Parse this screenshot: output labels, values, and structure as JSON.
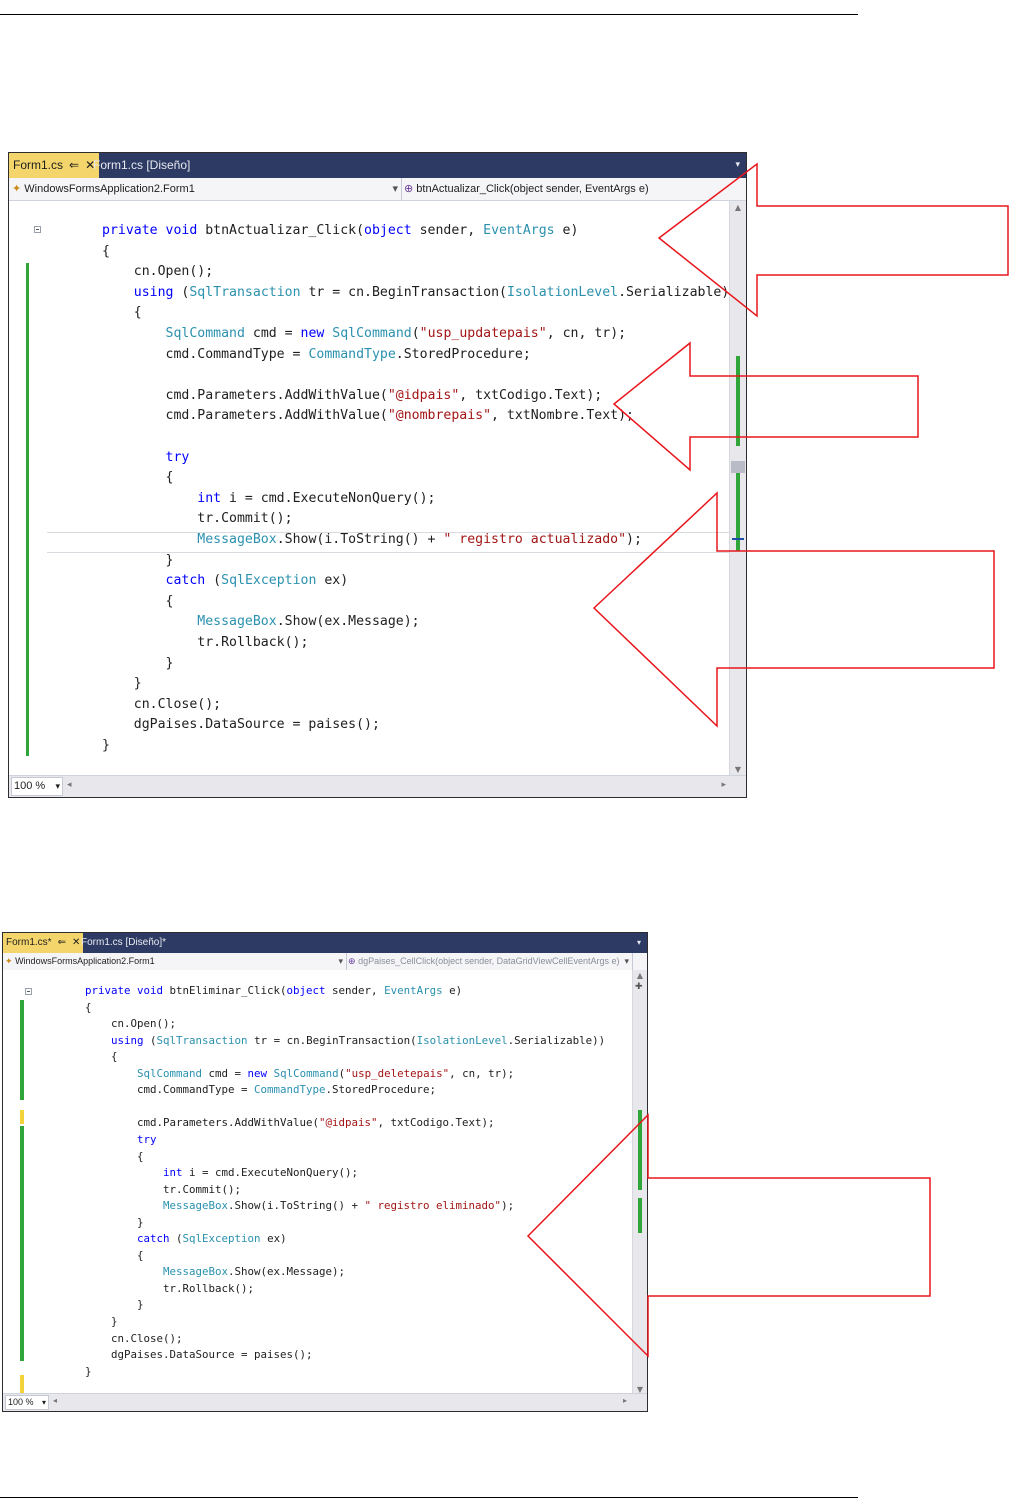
{
  "screenshot1": {
    "tabs": [
      {
        "label": "Form1.cs",
        "active": true,
        "pin": "⇐",
        "close": "✕"
      },
      {
        "label": "Form1.cs [Diseño]",
        "active": false
      }
    ],
    "nav_left": "WindowsFormsApplication2.Form1",
    "nav_right": "btnActualizar_Click(object sender, EventArgs e)",
    "zoom": "100 %",
    "lines": [
      [
        {
          "t": "private void ",
          "c": "kw"
        },
        {
          "t": "btnActualizar_Click("
        },
        {
          "t": "object",
          "c": "kw"
        },
        {
          "t": " sender, "
        },
        {
          "t": "EventArgs",
          "c": "ty"
        },
        {
          "t": " e)"
        }
      ],
      [
        {
          "t": "{"
        }
      ],
      [
        {
          "t": "    cn.Open();"
        }
      ],
      [
        {
          "t": "    "
        },
        {
          "t": "using",
          "c": "kw"
        },
        {
          "t": " ("
        },
        {
          "t": "SqlTransaction",
          "c": "ty"
        },
        {
          "t": " tr = cn.BeginTransaction("
        },
        {
          "t": "IsolationLevel",
          "c": "ty"
        },
        {
          "t": ".Serializable))"
        }
      ],
      [
        {
          "t": "    {"
        }
      ],
      [
        {
          "t": "        "
        },
        {
          "t": "SqlCommand",
          "c": "ty"
        },
        {
          "t": " cmd = "
        },
        {
          "t": "new",
          "c": "kw"
        },
        {
          "t": " "
        },
        {
          "t": "SqlCommand",
          "c": "ty"
        },
        {
          "t": "("
        },
        {
          "t": "\"usp_updatepais\"",
          "c": "st"
        },
        {
          "t": ", cn, tr);"
        }
      ],
      [
        {
          "t": "        cmd.CommandType = "
        },
        {
          "t": "CommandType",
          "c": "ty"
        },
        {
          "t": ".StoredProcedure;"
        }
      ],
      [],
      [
        {
          "t": "        cmd.Parameters.AddWithValue("
        },
        {
          "t": "\"@idpais\"",
          "c": "st"
        },
        {
          "t": ", txtCodigo.Text);"
        }
      ],
      [
        {
          "t": "        cmd.Parameters.AddWithValue("
        },
        {
          "t": "\"@nombrepais\"",
          "c": "st"
        },
        {
          "t": ", txtNombre.Text);"
        }
      ],
      [],
      [
        {
          "t": "        "
        },
        {
          "t": "try",
          "c": "kw"
        }
      ],
      [
        {
          "t": "        {"
        }
      ],
      [
        {
          "t": "            "
        },
        {
          "t": "int",
          "c": "kw"
        },
        {
          "t": " i = cmd.ExecuteNonQuery();"
        }
      ],
      [
        {
          "t": "            tr.Commit();"
        }
      ],
      [
        {
          "t": "            "
        },
        {
          "t": "MessageBox",
          "c": "ty"
        },
        {
          "t": ".Show(i.ToString() + "
        },
        {
          "t": "\" registro actualizado\"",
          "c": "st"
        },
        {
          "t": ");"
        }
      ],
      [
        {
          "t": "        }"
        }
      ],
      [
        {
          "t": "        "
        },
        {
          "t": "catch",
          "c": "kw"
        },
        {
          "t": " ("
        },
        {
          "t": "SqlException",
          "c": "ty"
        },
        {
          "t": " ex)"
        }
      ],
      [
        {
          "t": "        {"
        }
      ],
      [
        {
          "t": "            "
        },
        {
          "t": "MessageBox",
          "c": "ty"
        },
        {
          "t": ".Show(ex.Message);"
        }
      ],
      [
        {
          "t": "            tr.Rollback();"
        }
      ],
      [
        {
          "t": "        }"
        }
      ],
      [
        {
          "t": "    }"
        }
      ],
      [
        {
          "t": "    cn.Close();"
        }
      ],
      [
        {
          "t": "    dgPaises.DataSource = paises();"
        }
      ],
      [
        {
          "t": "}"
        }
      ]
    ]
  },
  "screenshot2": {
    "tabs": [
      {
        "label": "Form1.cs*",
        "active": true,
        "pin": "⇐",
        "close": "✕"
      },
      {
        "label": "Form1.cs [Diseño]*",
        "active": false
      }
    ],
    "nav_left": "WindowsFormsApplication2.Form1",
    "nav_right": "dgPaises_CellClick(object sender, DataGridViewCellEventArgs e)",
    "zoom": "100 %",
    "lines": [
      [
        {
          "t": "private void ",
          "c": "kw"
        },
        {
          "t": "btnEliminar_Click("
        },
        {
          "t": "object",
          "c": "kw"
        },
        {
          "t": " sender, "
        },
        {
          "t": "EventArgs",
          "c": "ty"
        },
        {
          "t": " e)"
        }
      ],
      [
        {
          "t": "{"
        }
      ],
      [
        {
          "t": "    cn.Open();"
        }
      ],
      [
        {
          "t": "    "
        },
        {
          "t": "using",
          "c": "kw"
        },
        {
          "t": " ("
        },
        {
          "t": "SqlTransaction",
          "c": "ty"
        },
        {
          "t": " tr = cn.BeginTransaction("
        },
        {
          "t": "IsolationLevel",
          "c": "ty"
        },
        {
          "t": ".Serializable))"
        }
      ],
      [
        {
          "t": "    {"
        }
      ],
      [
        {
          "t": "        "
        },
        {
          "t": "SqlCommand",
          "c": "ty"
        },
        {
          "t": " cmd = "
        },
        {
          "t": "new",
          "c": "kw"
        },
        {
          "t": " "
        },
        {
          "t": "SqlCommand",
          "c": "ty"
        },
        {
          "t": "("
        },
        {
          "t": "\"usp_deletepais\"",
          "c": "st"
        },
        {
          "t": ", cn, tr);"
        }
      ],
      [
        {
          "t": "        cmd.CommandType = "
        },
        {
          "t": "CommandType",
          "c": "ty"
        },
        {
          "t": ".StoredProcedure;"
        }
      ],
      [],
      [
        {
          "t": "        cmd.Parameters.AddWithValue("
        },
        {
          "t": "\"@idpais\"",
          "c": "st"
        },
        {
          "t": ", txtCodigo.Text);"
        }
      ],
      [
        {
          "t": "        "
        },
        {
          "t": "try",
          "c": "kw"
        }
      ],
      [
        {
          "t": "        {"
        }
      ],
      [
        {
          "t": "            "
        },
        {
          "t": "int",
          "c": "kw"
        },
        {
          "t": " i = cmd.ExecuteNonQuery();"
        }
      ],
      [
        {
          "t": "            tr.Commit();"
        }
      ],
      [
        {
          "t": "            "
        },
        {
          "t": "MessageBox",
          "c": "ty"
        },
        {
          "t": ".Show(i.ToString() + "
        },
        {
          "t": "\" registro eliminado\"",
          "c": "st"
        },
        {
          "t": ");"
        }
      ],
      [
        {
          "t": "        }"
        }
      ],
      [
        {
          "t": "        "
        },
        {
          "t": "catch",
          "c": "kw"
        },
        {
          "t": " ("
        },
        {
          "t": "SqlException",
          "c": "ty"
        },
        {
          "t": " ex)"
        }
      ],
      [
        {
          "t": "        {"
        }
      ],
      [
        {
          "t": "            "
        },
        {
          "t": "MessageBox",
          "c": "ty"
        },
        {
          "t": ".Show(ex.Message);"
        }
      ],
      [
        {
          "t": "            tr.Rollback();"
        }
      ],
      [
        {
          "t": "        }"
        }
      ],
      [
        {
          "t": "    }"
        }
      ],
      [
        {
          "t": "    cn.Close();"
        }
      ],
      [
        {
          "t": "    dgPaises.DataSource = paises();"
        }
      ],
      [
        {
          "t": "}"
        }
      ]
    ]
  },
  "colors": {
    "keyword": "#0000ff",
    "type": "#2b91af",
    "string": "#a31515",
    "annotation_arrow": "#e8161c",
    "change_bar": "#2fa53a",
    "tab_active": "#f4d56b",
    "tab_bar": "#2d3b64"
  },
  "icons": {
    "class_icon": "class-icon",
    "method_icon": "method-icon",
    "dropdown": "chevron-down-icon"
  }
}
